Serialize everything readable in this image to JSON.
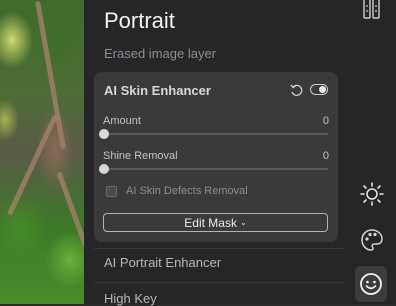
{
  "panel": {
    "title": "Portrait",
    "subtitle": "Erased image layer"
  },
  "skin_enhancer": {
    "title": "AI Skin Enhancer",
    "enabled": true,
    "amount": {
      "label": "Amount",
      "value": "0"
    },
    "shine": {
      "label": "Shine Removal",
      "value": "0"
    },
    "defects": {
      "label": "AI Skin Defects Removal",
      "checked": false
    },
    "edit_mask": "Edit Mask"
  },
  "list": {
    "portrait_enhancer": "AI Portrait Enhancer",
    "high_key": "High Key"
  },
  "side_tools": {
    "items": [
      "ruler-icon",
      "light-icon",
      "palette-icon",
      "portrait-face-icon"
    ],
    "selected": "portrait-face-icon"
  }
}
